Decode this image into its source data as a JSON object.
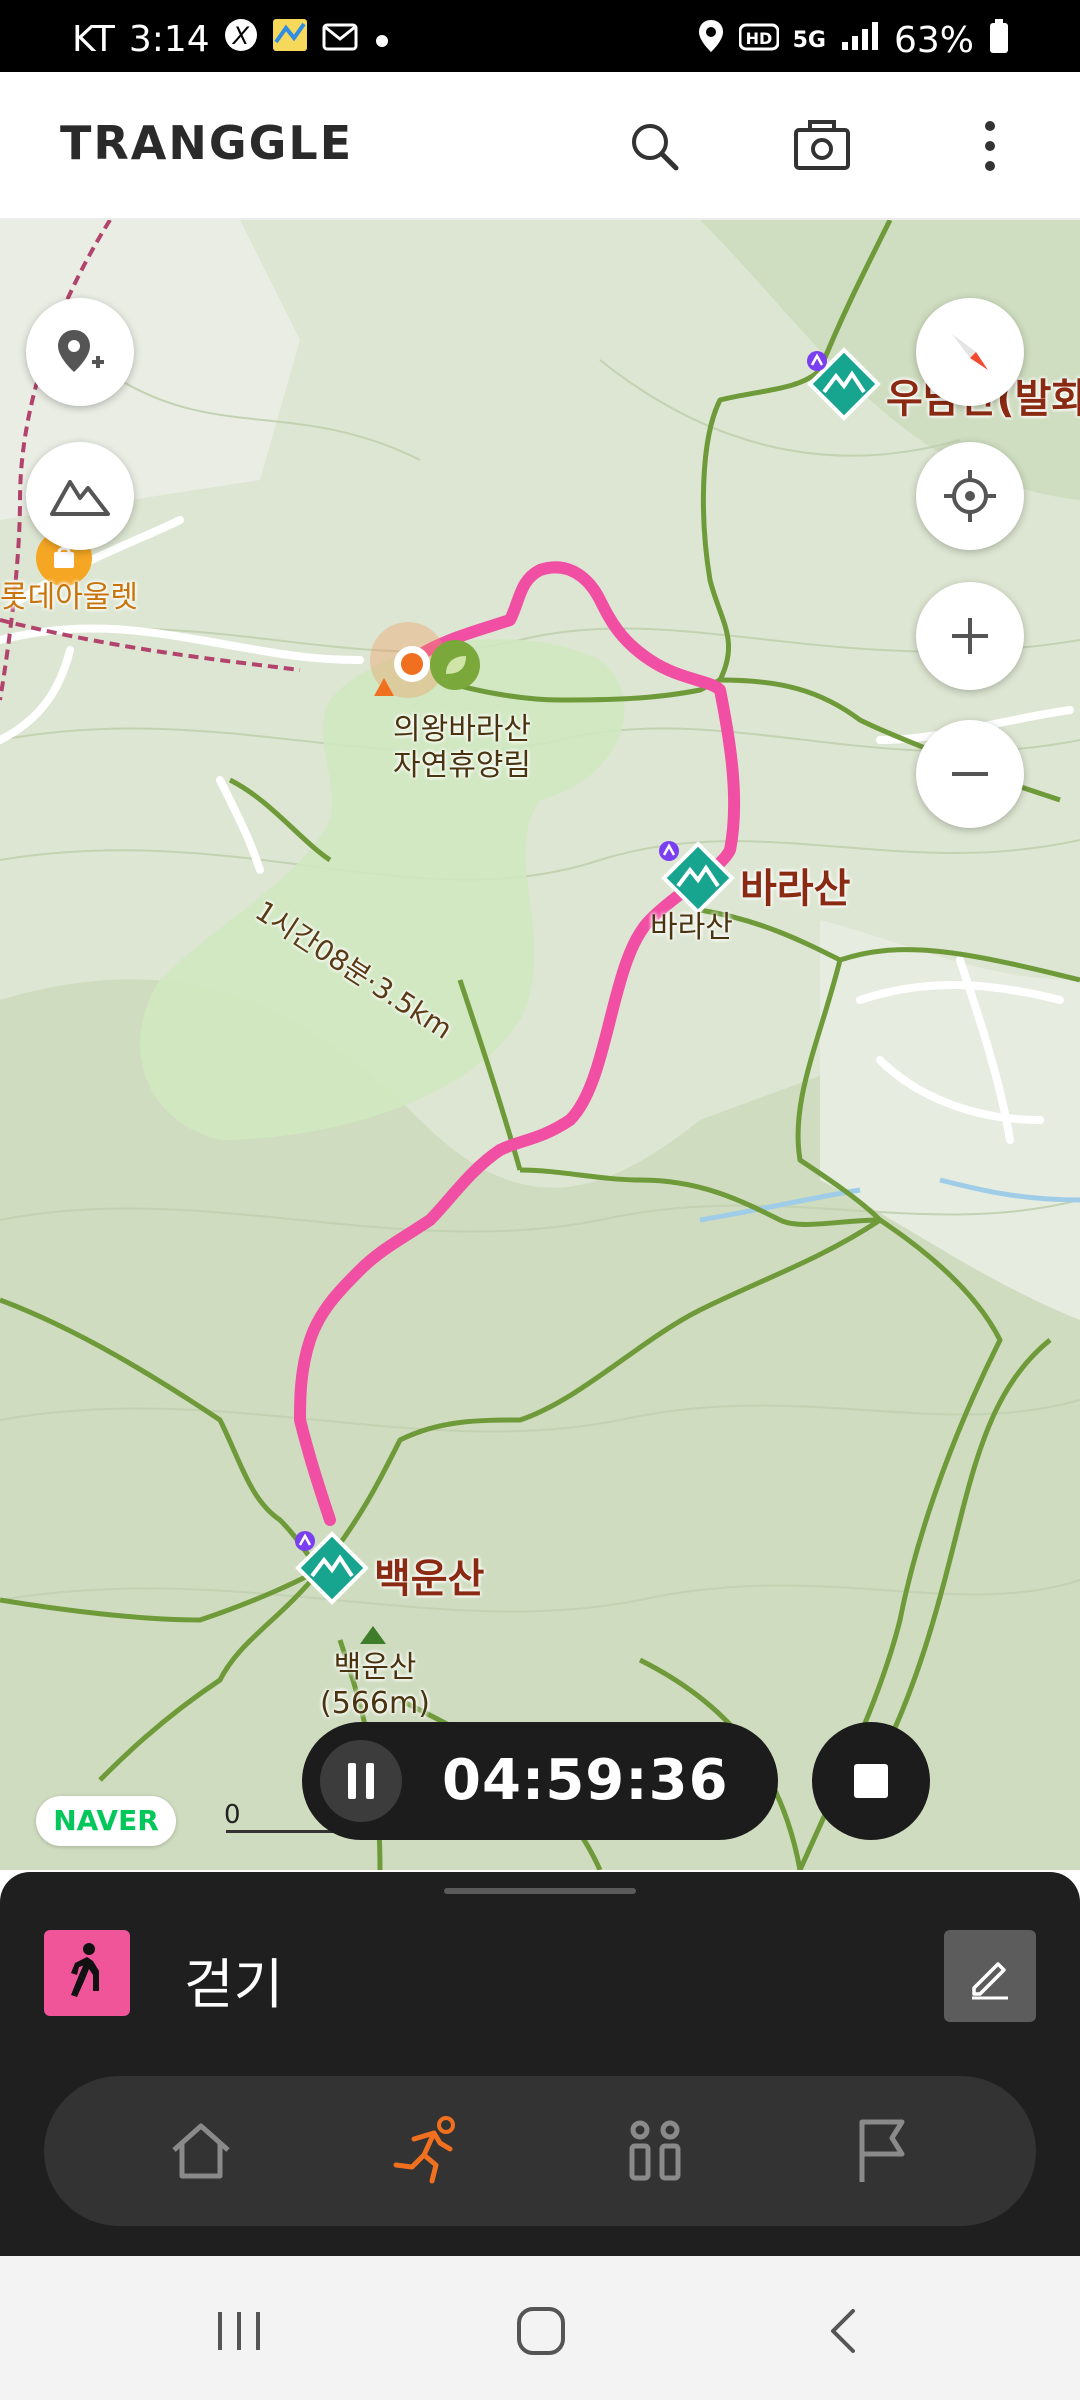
{
  "status_bar": {
    "carrier": "KT",
    "time": "3:14",
    "network": "5G",
    "battery": "63%"
  },
  "header": {
    "logo_text": "TRANGGLE",
    "icons": [
      "search-icon",
      "camera-icon",
      "more-vertical-icon"
    ]
  },
  "map": {
    "labels": {
      "place_left": "롯데아울렛",
      "forest_name": "의왕바라산\n자연휴양림",
      "trail_info": "1시간08분·3.5km",
      "peak_right_top": "우담산(발화",
      "barasan_big": "바라산",
      "barasan_small": "바라산",
      "baegunsan_big": "백운산",
      "baegunsan_small": "백운산\n(566m)"
    },
    "colors": {
      "route": "#f04fa3",
      "trail": "#6f9a3a",
      "marker": "#17a58f"
    },
    "scale": "0"
  },
  "tracking": {
    "elapsed": "04:59:36",
    "map_provider": "NAVER"
  },
  "bottom_sheet": {
    "activity_label": "걷기",
    "nav_icons": [
      "home-icon",
      "running-icon",
      "people-icon",
      "flag-icon"
    ],
    "active_tab": "running-icon",
    "accent_color": "#f07020"
  }
}
